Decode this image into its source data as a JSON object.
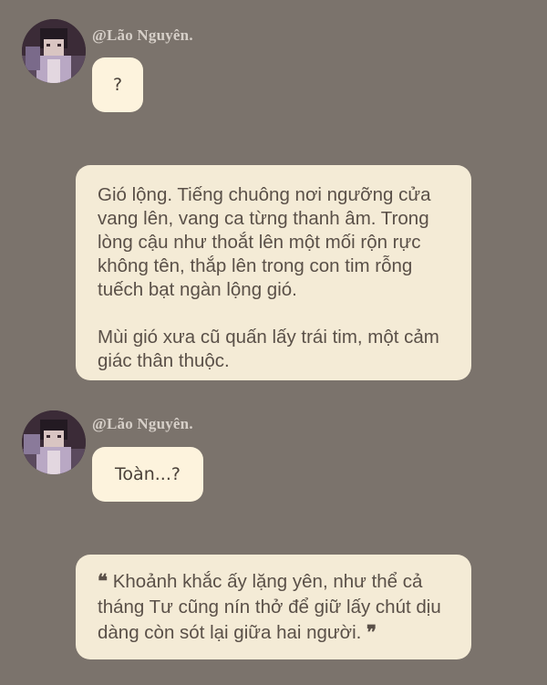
{
  "messages": [
    {
      "author": "@Lão Nguyên.",
      "text": "?"
    },
    {
      "author": "@Lão Nguyên.",
      "text": "Toàn...?"
    }
  ],
  "narration": [
    {
      "paragraphs": [
        "Gió lộng. Tiếng chuông nơi ngưỡng cửa vang lên, vang ca từng thanh âm. Trong lòng cậu như thoắt lên một mối rộn rực không tên, thắp lên trong con tim rỗng tuếch bạt ngàn lộng gió.",
        "Mùi gió xưa cũ quấn lấy trái tim, một cảm giác thân thuộc."
      ]
    },
    {
      "open_quote": "❝",
      "close_quote": "❞",
      "text": "Khoảnh khắc ấy lặng yên, như thể cả tháng Tư cũng nín thở để giữ lấy chút dịu dàng còn sót lại giữa hai người."
    }
  ]
}
